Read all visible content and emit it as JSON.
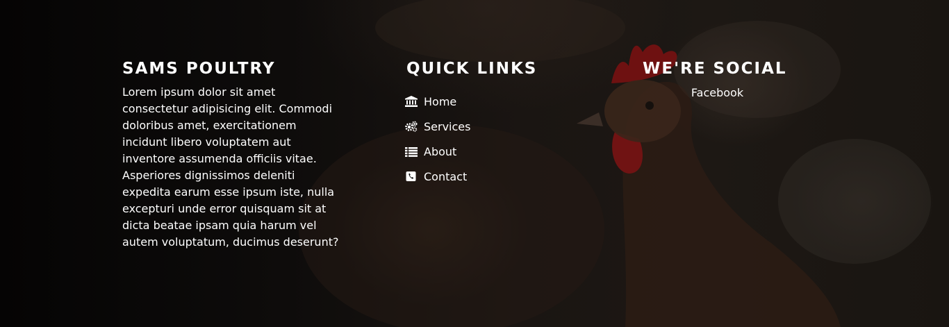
{
  "about": {
    "title": "SAMS POULTRY",
    "text": "Lorem ipsum dolor sit amet consectetur adipisicing elit. Commodi doloribus amet, exercitationem incidunt libero voluptatem aut inventore assumenda officiis vitae. Asperiores dignissimos deleniti expedita earum esse ipsum iste, nulla excepturi unde error quisquam sit at dicta beatae ipsam quia harum vel autem voluptatum, ducimus deserunt?"
  },
  "quick_links": {
    "title": "QUICK LINKS",
    "items": [
      {
        "label": "Home",
        "icon": "bank-icon"
      },
      {
        "label": "Services",
        "icon": "gears-icon"
      },
      {
        "label": "About",
        "icon": "list-icon"
      },
      {
        "label": "Contact",
        "icon": "phone-icon"
      }
    ]
  },
  "social": {
    "title": "WE'RE SOCIAL",
    "links": [
      {
        "label": "Facebook"
      }
    ]
  },
  "colors": {
    "text": "#ffffff",
    "background": "#0b0908"
  }
}
